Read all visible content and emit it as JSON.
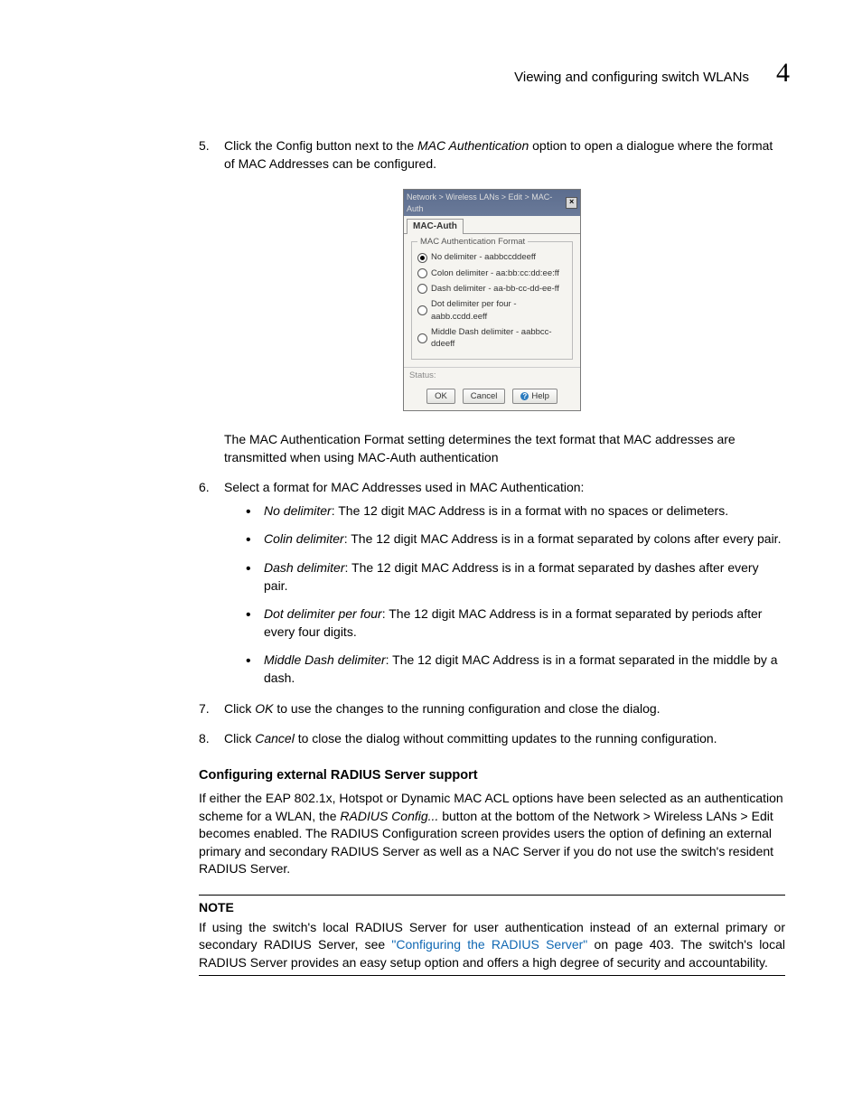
{
  "header": {
    "title": "Viewing and configuring switch WLANs",
    "chapter": "4"
  },
  "steps": {
    "s5": {
      "num": "5.",
      "pre": "Click the Config button next to the ",
      "em": "MAC Authentication",
      "post": " option to open a dialogue where the format of MAC Addresses can be configured."
    },
    "para_after_dialog": "The MAC Authentication Format setting determines the text format that MAC addresses are transmitted when using MAC-Auth authentication",
    "s6": {
      "num": "6.",
      "text": "Select a format for MAC Addresses used in MAC Authentication:"
    },
    "bullets": {
      "b1_em": "No delimiter",
      "b1_rest": ": The 12 digit MAC Address is in a format with no spaces or delimeters.",
      "b2_em": "Colin delimiter",
      "b2_rest": ": The 12 digit MAC Address is in a format separated by colons after every pair.",
      "b3_em": "Dash delimiter",
      "b3_rest": ": The 12 digit MAC Address is in a format separated by dashes after every pair.",
      "b4_em": "Dot delimiter per four",
      "b4_rest": ": The 12 digit MAC Address is in a format separated by periods after every four digits.",
      "b5_em": "Middle Dash delimiter",
      "b5_rest": ": The 12 digit MAC Address is in a format separated in the middle by a dash."
    },
    "s7": {
      "num": "7.",
      "pre": "Click ",
      "em": "OK",
      "post": " to use the changes to the running configuration and close the dialog."
    },
    "s8": {
      "num": "8.",
      "pre": "Click ",
      "em": "Cancel",
      "post": " to close the dialog without committing updates to the running configuration."
    }
  },
  "dialog": {
    "titlebar": "Network > Wireless LANs > Edit > MAC-Auth",
    "tab": "MAC-Auth",
    "legend": "MAC Authentication Format",
    "options": {
      "o1": "No delimiter - aabbccddeeff",
      "o2": "Colon delimiter - aa:bb:cc:dd:ee:ff",
      "o3": "Dash delimiter - aa-bb-cc-dd-ee-ff",
      "o4": "Dot delimiter per four - aabb.ccdd.eeff",
      "o5": "Middle Dash delimiter - aabbcc-ddeeff"
    },
    "status": "Status:",
    "btn_ok": "OK",
    "btn_cancel": "Cancel",
    "btn_help": "Help"
  },
  "radius": {
    "heading": "Configuring external RADIUS Server support",
    "p1a": "If either the EAP 802.1x, Hotspot or Dynamic MAC ACL options have been selected as an authentication scheme for a WLAN, the ",
    "p1em": "RADIUS Config...",
    "p1b": " button at the bottom of the Network > Wireless LANs > Edit becomes enabled. The RADIUS Configuration screen provides users the option of defining an external primary and secondary RADIUS Server as well as a NAC Server if you do not use the switch's resident RADIUS Server."
  },
  "note": {
    "label": "NOTE",
    "a": "If using the switch's local RADIUS Server for user authentication instead of an external primary or secondary RADIUS Server, see ",
    "link": "\"Configuring the RADIUS Server\"",
    "b": " on page 403. The switch's local RADIUS Server provides an easy setup option and offers a high degree of security and accountability."
  }
}
